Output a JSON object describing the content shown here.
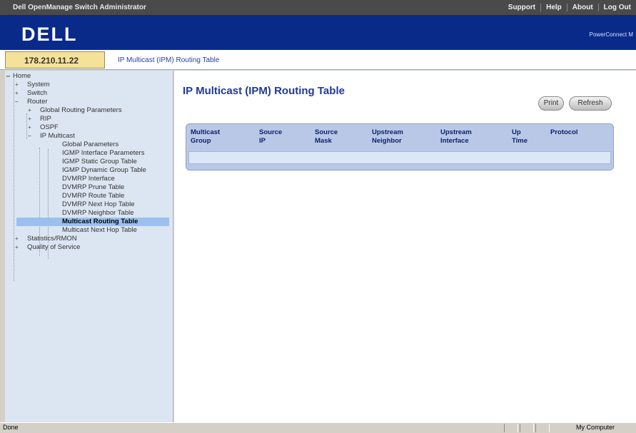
{
  "topbar": {
    "app_title": "Dell OpenManage Switch Administrator",
    "links": [
      "Support",
      "Help",
      "About",
      "Log Out"
    ]
  },
  "banner": {
    "logo": "DELL",
    "product": "PowerConnect M"
  },
  "address": {
    "ip": "178.210.11.22",
    "breadcrumb": "IP Multicast (IPM) Routing Table"
  },
  "tree": {
    "home": "Home",
    "system": "System",
    "switch": "Switch",
    "router": "Router",
    "global_routing": "Global Routing Parameters",
    "rip": "RIP",
    "ospf": "OSPF",
    "ip_multicast": "IP Multicast",
    "items": [
      "Global Parameters",
      "IGMP Interface Parameters",
      "IGMP Static Group Table",
      "IGMP Dynamic Group Table",
      "DVMRP Interface",
      "DVMRP Prune Table",
      "DVMRP Route Table",
      "DVMRP Next Hop Table",
      "DVMRP Neighbor Table",
      "Multicast Routing Table",
      "Multicast Next Hop Table"
    ],
    "statistics": "Statistics/RMON",
    "qos": "Quality of Service"
  },
  "main": {
    "title": "IP Multicast (IPM) Routing Table",
    "print_label": "Print",
    "refresh_label": "Refresh",
    "columns": [
      "Multicast\nGroup",
      "Source\nIP",
      "Source\nMask",
      "Upstream\nNeighbor",
      "Upstream\nInterface",
      "Up\nTime",
      "Protocol"
    ]
  },
  "status": {
    "done": "Done",
    "zone": "My Computer"
  },
  "colors": {
    "banner": "#0a2a8a",
    "tree_bg": "#dce6f2",
    "title": "#1f3a93",
    "table_header": "#b9c8e6",
    "ip_box": "#f5e29a"
  }
}
